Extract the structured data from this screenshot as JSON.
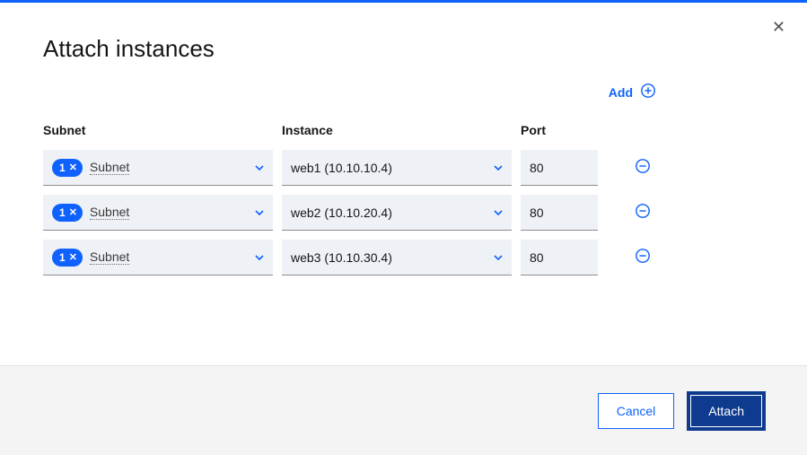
{
  "modal": {
    "title": "Attach instances",
    "add_label": "Add",
    "headers": {
      "subnet": "Subnet",
      "instance": "Instance",
      "port": "Port"
    },
    "rows": [
      {
        "chip_count": "1",
        "subnet_label": "Subnet",
        "instance": "web1 (10.10.10.4)",
        "port": "80"
      },
      {
        "chip_count": "1",
        "subnet_label": "Subnet",
        "instance": "web2 (10.10.20.4)",
        "port": "80"
      },
      {
        "chip_count": "1",
        "subnet_label": "Subnet",
        "instance": "web3 (10.10.30.4)",
        "port": "80"
      }
    ],
    "footer": {
      "cancel": "Cancel",
      "attach": "Attach"
    }
  }
}
